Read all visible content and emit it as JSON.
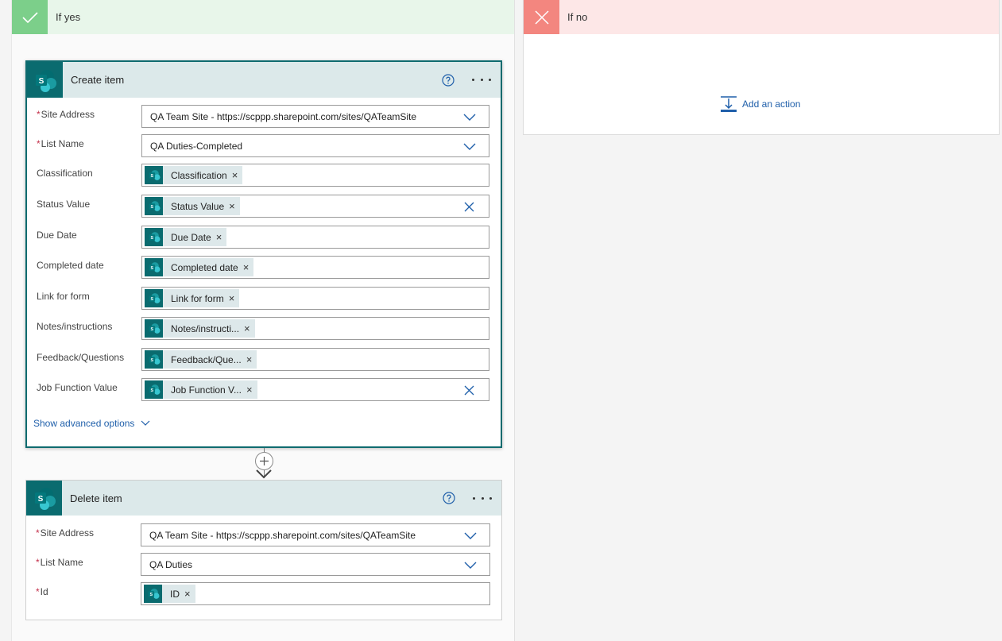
{
  "yes_branch": {
    "title": "If yes",
    "create_item": {
      "title": "Create item",
      "fields": [
        {
          "label": "Site Address",
          "required": true,
          "kind": "dropdown",
          "value": "QA Team Site - https://scppp.sharepoint.com/sites/QATeamSite"
        },
        {
          "label": "List Name",
          "required": true,
          "kind": "dropdown",
          "value": "QA Duties-Completed"
        },
        {
          "label": "Classification",
          "required": false,
          "kind": "token",
          "token": "Classification",
          "clear": false
        },
        {
          "label": "Status Value",
          "required": false,
          "kind": "token",
          "token": "Status Value",
          "clear": true
        },
        {
          "label": "Due Date",
          "required": false,
          "kind": "token",
          "token": "Due Date",
          "clear": false
        },
        {
          "label": "Completed date",
          "required": false,
          "kind": "token",
          "token": "Completed date",
          "clear": false
        },
        {
          "label": "Link for form",
          "required": false,
          "kind": "token",
          "token": "Link for form",
          "clear": false
        },
        {
          "label": "Notes/instructions",
          "required": false,
          "kind": "token",
          "token": "Notes/instructi...",
          "clear": false
        },
        {
          "label": "Feedback/Questions",
          "required": false,
          "kind": "token",
          "token": "Feedback/Que...",
          "clear": false
        },
        {
          "label": "Job Function Value",
          "required": false,
          "kind": "token",
          "token": "Job Function V...",
          "clear": true
        }
      ],
      "advanced_label": "Show advanced options"
    },
    "delete_item": {
      "title": "Delete item",
      "fields": [
        {
          "label": "Site Address",
          "required": true,
          "kind": "dropdown",
          "value": "QA Team Site - https://scppp.sharepoint.com/sites/QATeamSite"
        },
        {
          "label": "List Name",
          "required": true,
          "kind": "dropdown",
          "value": "QA Duties"
        },
        {
          "label": "Id",
          "required": true,
          "kind": "token",
          "token": "ID",
          "clear": false
        }
      ]
    }
  },
  "no_branch": {
    "title": "If no",
    "add_action_label": "Add an action"
  },
  "required_marker": "*",
  "token_close_glyph": "×",
  "sharepoint_letter": "S",
  "colors": {
    "yes_header": "#e8f6ea",
    "yes_icon": "#7ccf8a",
    "no_header": "#fde7e7",
    "no_icon": "#f3867f",
    "sharepoint": "#0a6b6f",
    "card_header": "#dce9ea",
    "link": "#1f5faa"
  }
}
